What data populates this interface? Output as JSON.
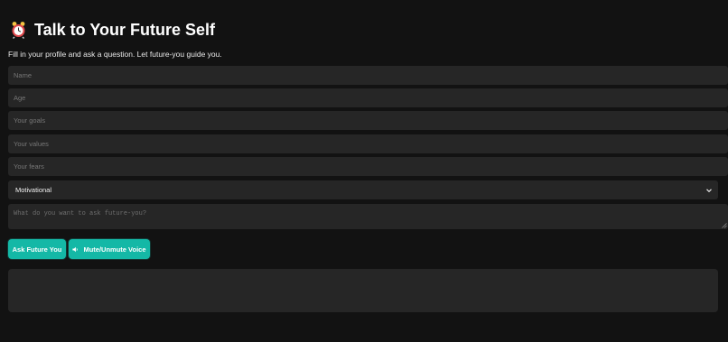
{
  "header": {
    "icon": "alarm-clock-icon",
    "title": "Talk to Your Future Self",
    "subtitle": "Fill in your profile and ask a question. Let future-you guide you."
  },
  "form": {
    "name": {
      "placeholder": "Name",
      "value": ""
    },
    "age": {
      "placeholder": "Age",
      "value": ""
    },
    "goals": {
      "placeholder": "Your goals",
      "value": ""
    },
    "values": {
      "placeholder": "Your values",
      "value": ""
    },
    "fears": {
      "placeholder": "Your fears",
      "value": ""
    },
    "tone": {
      "selected": "Motivational"
    },
    "question": {
      "placeholder": "What do you want to ask future-you?",
      "value": ""
    }
  },
  "actions": {
    "ask_label": "Ask Future You",
    "mute_label": "Mute/Unmute Voice",
    "mute_icon": "speaker-icon"
  },
  "response": {
    "text": ""
  },
  "colors": {
    "background": "#121212",
    "field": "#262626",
    "accent": "#14b8a6",
    "alarm_clock": "#e0484c"
  }
}
